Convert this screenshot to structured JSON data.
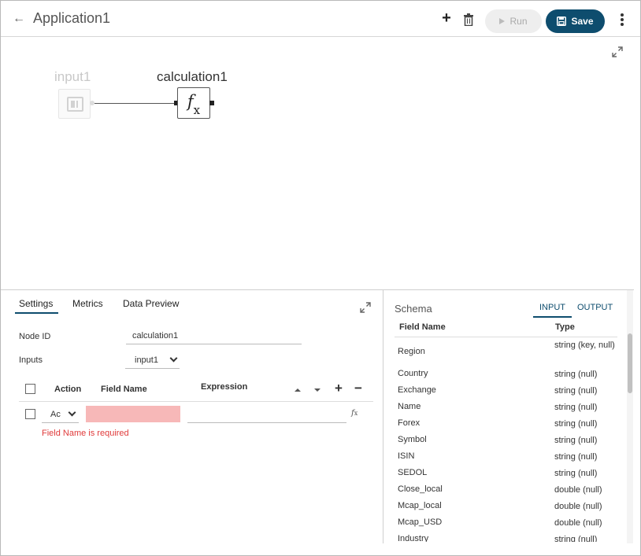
{
  "header": {
    "title": "Application1",
    "run_label": "Run",
    "save_label": "Save"
  },
  "canvas": {
    "nodes": [
      {
        "label": "input1",
        "type": "input",
        "active": false
      },
      {
        "label": "calculation1",
        "type": "calculation",
        "icon": "fx",
        "active": true
      }
    ]
  },
  "settings": {
    "tabs": [
      {
        "label": "Settings",
        "active": true
      },
      {
        "label": "Metrics",
        "active": false
      },
      {
        "label": "Data Preview",
        "active": false
      }
    ],
    "node_id_label": "Node ID",
    "node_id_value": "calculation1",
    "inputs_label": "Inputs",
    "inputs_value": "input1",
    "table": {
      "columns": [
        "Action",
        "Field Name",
        "Expression"
      ],
      "rows": [
        {
          "action": "Ac",
          "field_name": "",
          "expression": ""
        }
      ]
    },
    "error": "Field Name is required"
  },
  "schema": {
    "title": "Schema",
    "tabs": [
      {
        "label": "INPUT",
        "active": true
      },
      {
        "label": "OUTPUT",
        "active": false
      }
    ],
    "columns": [
      "Field Name",
      "Type"
    ],
    "rows": [
      {
        "name": "Region",
        "type": "string (key, null)"
      },
      {
        "name": "Country",
        "type": "string (null)"
      },
      {
        "name": "Exchange",
        "type": "string (null)"
      },
      {
        "name": "Name",
        "type": "string (null)"
      },
      {
        "name": "Forex",
        "type": "string (null)"
      },
      {
        "name": "Symbol",
        "type": "string (null)"
      },
      {
        "name": "ISIN",
        "type": "string (null)"
      },
      {
        "name": "SEDOL",
        "type": "string (null)"
      },
      {
        "name": "Close_local",
        "type": "double (null)"
      },
      {
        "name": "Mcap_local",
        "type": "double (null)"
      },
      {
        "name": "Mcap_USD",
        "type": "double (null)"
      },
      {
        "name": "Industry",
        "type": "string (null)"
      }
    ]
  },
  "colors": {
    "accent": "#0e4d6e",
    "error": "#e03a3a",
    "error_field_bg": "#f7b8b8"
  }
}
